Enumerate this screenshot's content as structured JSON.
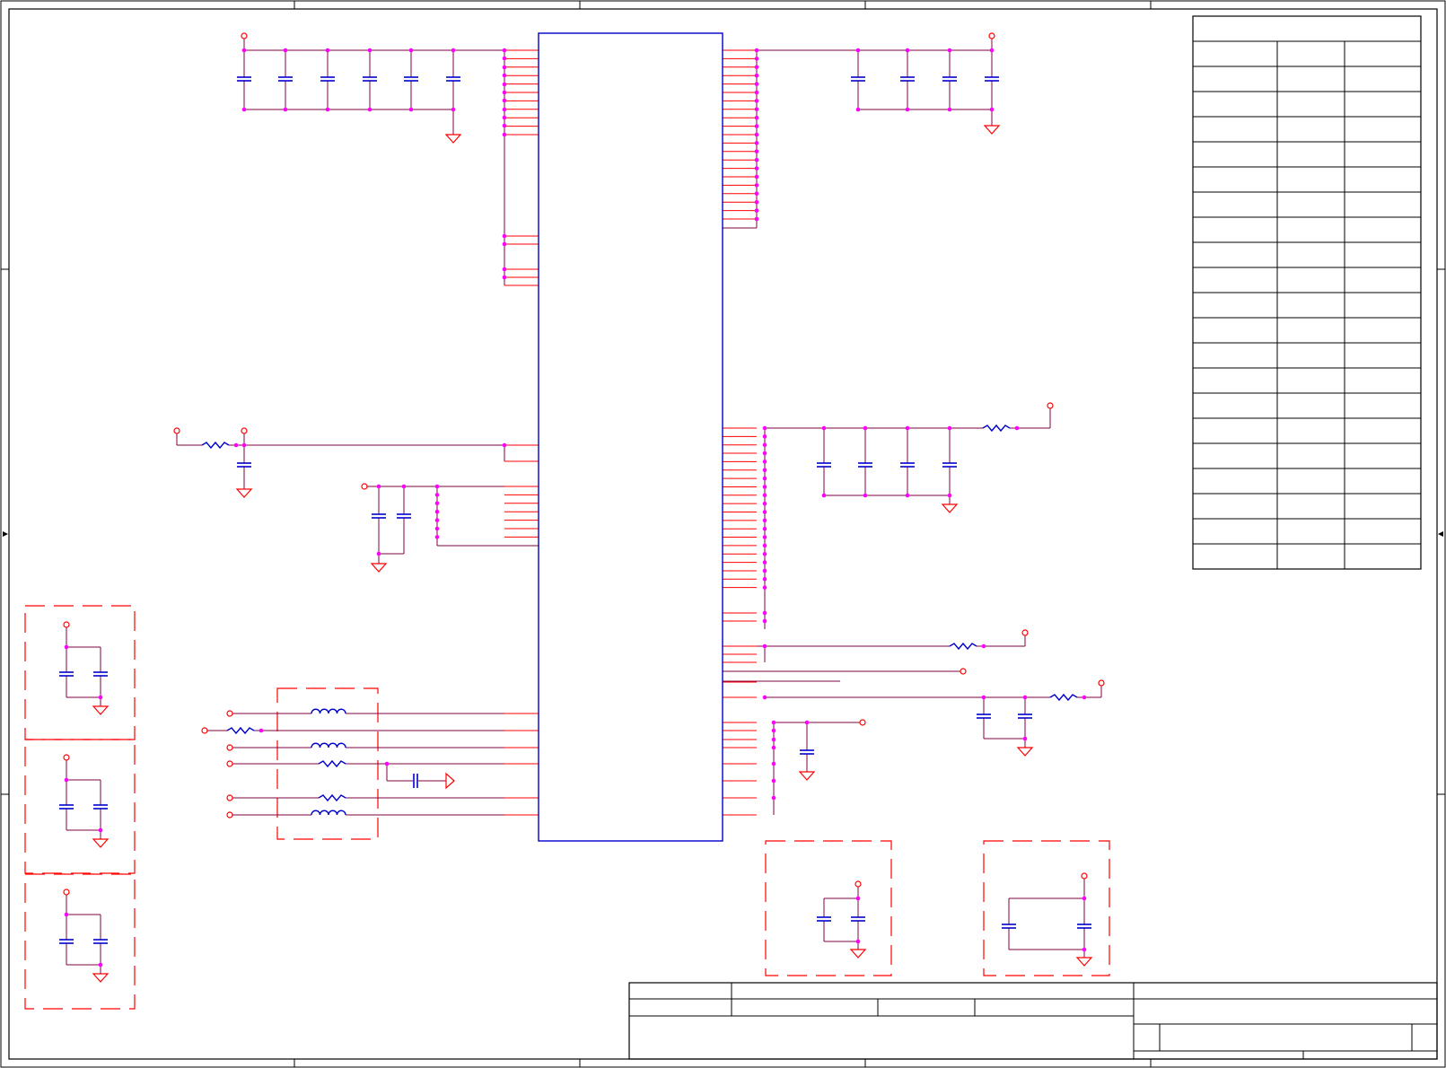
{
  "sheet": {
    "title": "",
    "colors": {
      "frame": "#000000",
      "wire": "#800040",
      "pin": "#ff0000",
      "component": "#0000cc",
      "junction": "#ff00ff",
      "group_border": "#ff0000",
      "background": "#ffffff"
    },
    "main_ic": {
      "left_pins": 40,
      "right_pins": 68,
      "label": ""
    },
    "pin_table": {
      "columns": 3,
      "rows": 21,
      "header": ""
    },
    "title_block": {
      "title": "",
      "size": "",
      "number": "",
      "revision": "",
      "date": "",
      "file": "",
      "sheet_of": "",
      "drawn_by": ""
    }
  }
}
